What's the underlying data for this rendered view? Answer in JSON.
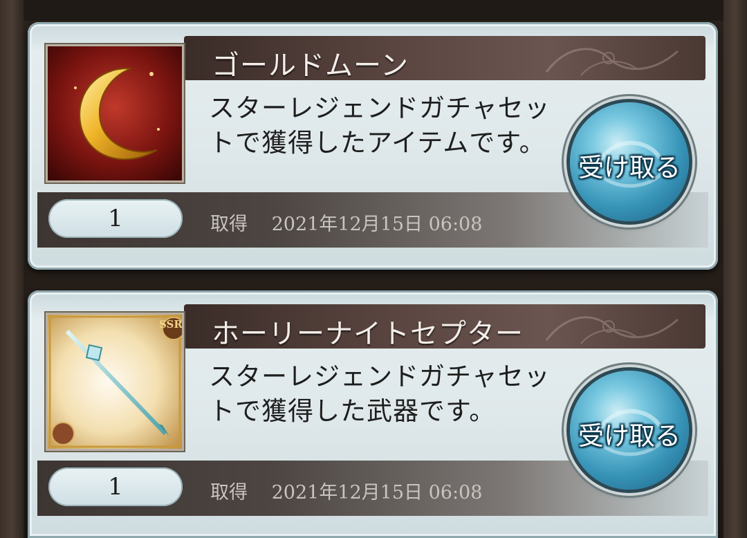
{
  "items": [
    {
      "name": "ゴールドムーン",
      "description_line1": "スターレジェンドガチャセッ",
      "description_line2": "トで獲得したアイテムです。",
      "quantity": "1",
      "acquired_label": "取得",
      "acquired_datetime": "2021年12月15日 06:08",
      "receive_label": "受け取る",
      "thumbnail_icon": "gold-moon-icon"
    },
    {
      "name": "ホーリーナイトセプター",
      "description_line1": "スターレジェンドガチャセッ",
      "description_line2": "トで獲得した武器です。",
      "quantity": "1",
      "acquired_label": "取得",
      "acquired_datetime": "2021年12月15日 06:08",
      "receive_label": "受け取る",
      "thumbnail_icon": "scepter-icon",
      "rarity_badge": "SSR"
    }
  ]
}
